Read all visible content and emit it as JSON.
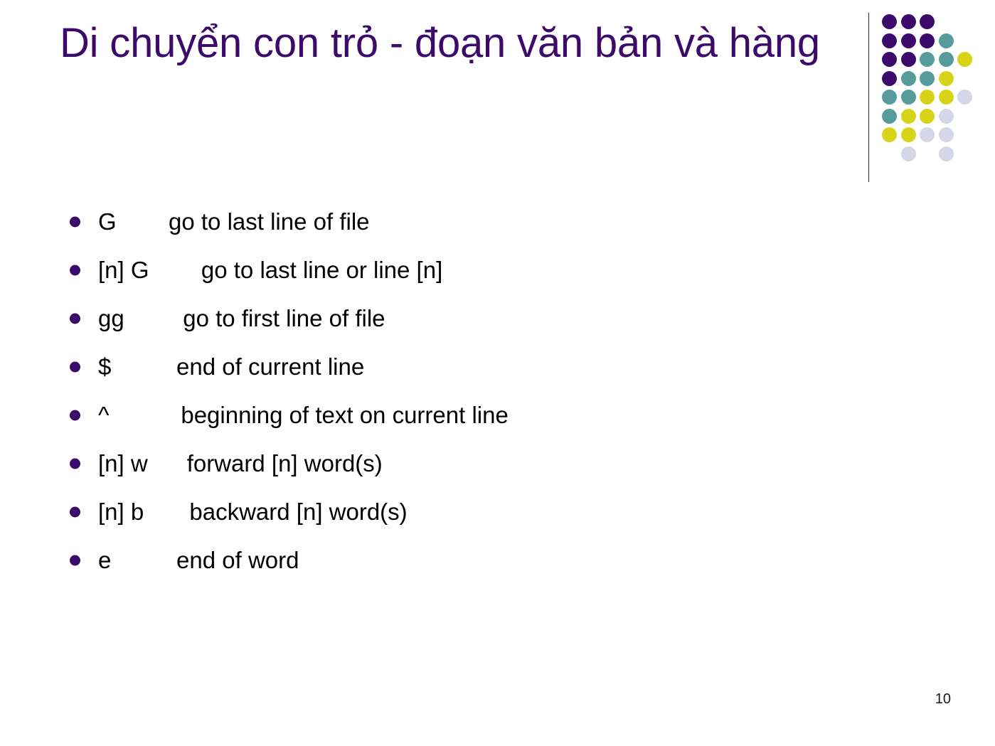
{
  "slide": {
    "title": "Di chuyển con trỏ - đoạn văn bản và hàng",
    "page_number": "10",
    "title_color": "#3B0A6B",
    "body_text_color": "#000000",
    "background_color": "#FFFFFF"
  },
  "bullets": [
    {
      "text": "G        go to last line of file"
    },
    {
      "text": "[n] G        go to last line or line [n]"
    },
    {
      "text": "gg         go to first line of file"
    },
    {
      "text": "$          end of current line"
    },
    {
      "text": "^           beginning of text on current line"
    },
    {
      "text": "[n] w      forward [n] word(s)"
    },
    {
      "text": "[n] b       backward [n] word(s)"
    },
    {
      "text": "e          end of word"
    }
  ],
  "decoration": {
    "palette": {
      "purple": "#3B0A6B",
      "teal": "#579B9B",
      "yellow": "#D7D317",
      "lavender": "#D6D6EA"
    },
    "divider_color": "#2B2B2B",
    "dot_grid": [
      [
        "purple",
        "purple",
        "purple",
        null,
        null
      ],
      [
        "purple",
        "purple",
        "purple",
        "teal",
        null
      ],
      [
        "purple",
        "purple",
        "teal",
        "teal",
        "yellow"
      ],
      [
        "purple",
        "teal",
        "teal",
        "yellow",
        null
      ],
      [
        "teal",
        "teal",
        "yellow",
        "yellow",
        "lavender"
      ],
      [
        "teal",
        "yellow",
        "yellow",
        "lavender",
        null
      ],
      [
        "yellow",
        "yellow",
        "lavender",
        "lavender",
        null
      ],
      [
        null,
        "lavender",
        null,
        "lavender",
        null
      ]
    ],
    "dot_pitch_x": 26.5,
    "dot_pitch_y": 26.5
  }
}
